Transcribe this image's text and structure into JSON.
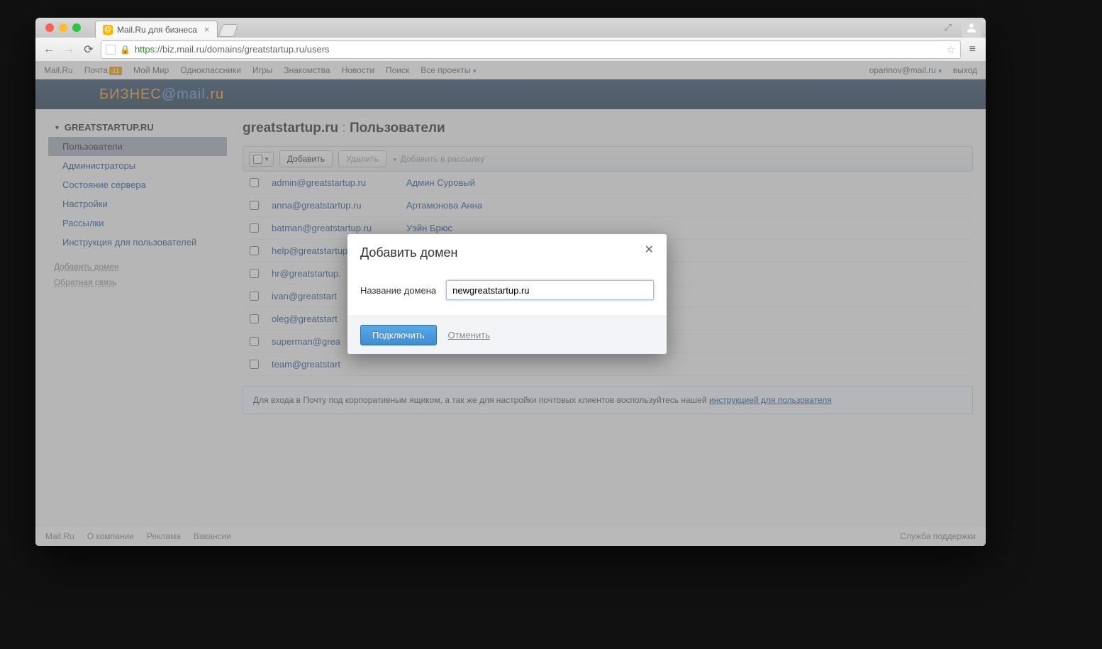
{
  "browser": {
    "tab_title": "Mail.Ru для бизнеса",
    "url_secure": "https",
    "url_rest": "://biz.mail.ru/domains/greatstartup.ru/users"
  },
  "portal": {
    "items": [
      "Mail.Ru",
      "Почта",
      "Мой Мир",
      "Одноклассники",
      "Игры",
      "Знакомства",
      "Новости",
      "Поиск",
      "Все проекты"
    ],
    "mail_badge": "21",
    "user_email": "oparinov@mail.ru",
    "logout": "выход"
  },
  "brand": {
    "biz": "БИЗНЕС",
    "mail": "mail",
    "ru": ".ru"
  },
  "sidebar": {
    "domain": "GREATSTARTUP.RU",
    "items": [
      "Пользователи",
      "Администраторы",
      "Состояние сервера",
      "Настройки",
      "Рассылки",
      "Инструкция для пользователей"
    ],
    "links": [
      "Добавить домен",
      "Обратная связь"
    ]
  },
  "main": {
    "title_domain": "greatstartup.ru",
    "title_sep": " : ",
    "title_section": "Пользователи",
    "toolbar": {
      "add": "Добавить",
      "delete": "Удалить",
      "add_to_list": "Добавить в рассылку"
    },
    "rows": [
      {
        "email": "admin@greatstartup.ru",
        "name": "Админ Суровый"
      },
      {
        "email": "anna@greatstartup.ru",
        "name": "Артамонова Анна"
      },
      {
        "email": "batman@greatstartup.ru",
        "name": "Уэйн Брюс"
      },
      {
        "email": "help@greatstartup.ru",
        "name": ""
      },
      {
        "email": "hr@greatstartup.",
        "name": ""
      },
      {
        "email": "ivan@greatstart",
        "name": ""
      },
      {
        "email": "oleg@greatstart",
        "name": ""
      },
      {
        "email": "superman@grea",
        "name": ""
      },
      {
        "email": "team@greatstart",
        "name": ""
      }
    ],
    "notice_pre": "Для входа в Почту под корпоративным ящиком, а так же для настройки почтовых клиентов воспользуйтесь нашей ",
    "notice_link": "инструкцией для пользователя"
  },
  "footer": {
    "items": [
      "Mail.Ru",
      "О компании",
      "Реклама",
      "Вакансии"
    ],
    "support": "Служба поддержки"
  },
  "modal": {
    "title": "Добавить домен",
    "label": "Название домена",
    "value": "newgreatstartup.ru",
    "submit": "Подключить",
    "cancel": "Отменить"
  }
}
